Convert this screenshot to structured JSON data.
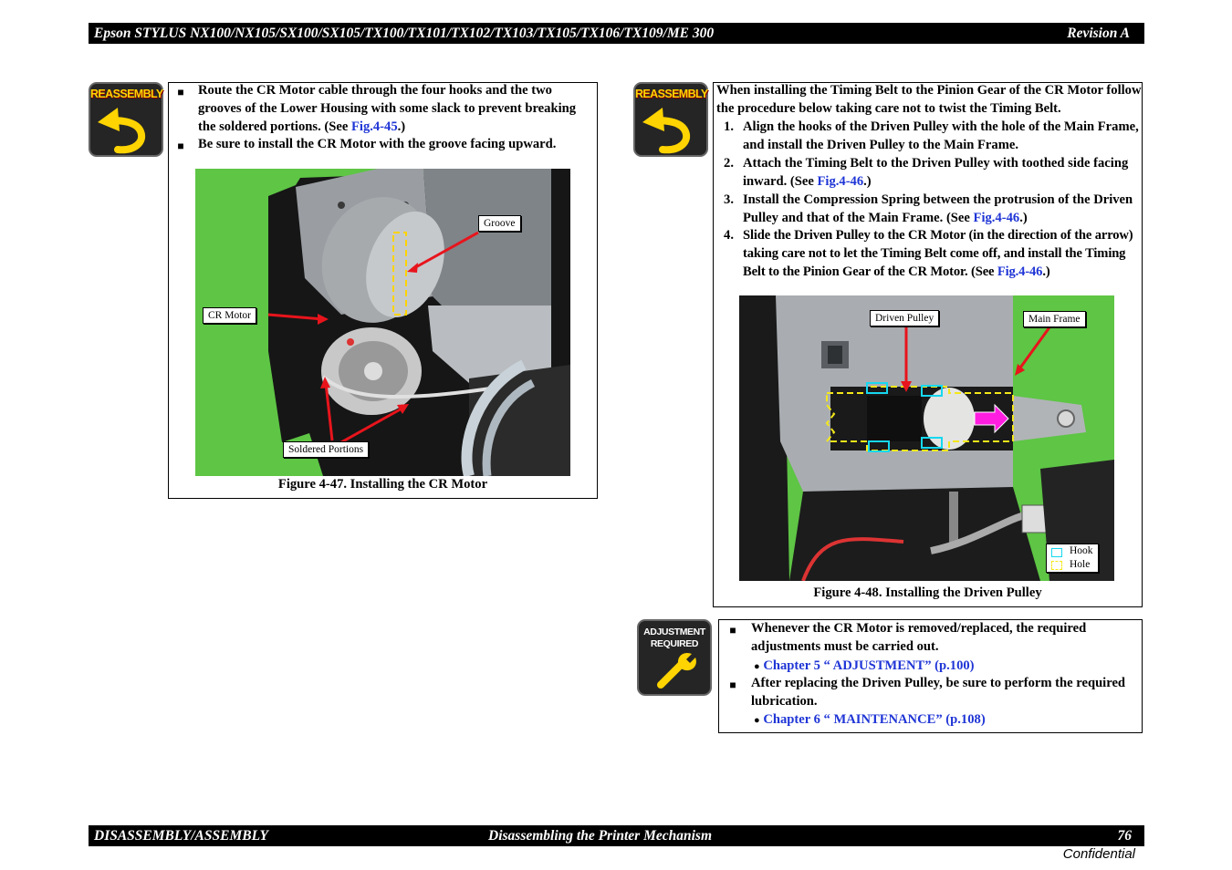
{
  "header": {
    "title": "Epson STYLUS NX100/NX105/SX100/SX105/TX100/TX101/TX102/TX103/TX105/TX106/TX109/ME 300",
    "revision": "Revision A"
  },
  "footer": {
    "section": "DISASSEMBLY/ASSEMBLY",
    "subsection": "Disassembling the Printer Mechanism",
    "page": "76",
    "confidential": "Confidential"
  },
  "icons": {
    "reassembly": "REASSEMBLY",
    "adjustment_line1": "ADJUSTMENT",
    "adjustment_line2": "REQUIRED"
  },
  "left_note": {
    "bullet1_pre": "Route the CR Motor cable through the four hooks and the two grooves of the Lower Housing with some slack to prevent breaking the soldered portions. (See ",
    "bullet1_link": "Fig.4-45",
    "bullet1_post": ".)",
    "bullet2": "Be sure to install the CR Motor with the groove facing upward.",
    "figure_caption": "Figure 4-47.  Installing the CR Motor",
    "labels": {
      "groove": "Groove",
      "cr_motor": "CR Motor",
      "soldered": "Soldered Portions"
    }
  },
  "right_note": {
    "intro": "When installing the Timing Belt to the Pinion Gear of the CR Motor follow the procedure below taking care not to twist the Timing Belt.",
    "steps": [
      {
        "num": "1.",
        "text": "Align the hooks of the Driven Pulley with the hole of the Main Frame, and install the Driven Pulley to the Main Frame."
      },
      {
        "num": "2.",
        "pre": "Attach the Timing Belt to the Driven Pulley with toothed side facing inward. (See ",
        "link": "Fig.4-46",
        "post": ".)"
      },
      {
        "num": "3.",
        "pre": "Install the Compression Spring between the protrusion of the Driven Pulley and that of the Main Frame. (See ",
        "link": "Fig.4-46",
        "post": ".)"
      },
      {
        "num": "4.",
        "pre": "Slide the Driven Pulley to the CR Motor (in the direction of the arrow) taking care not to let the Timing Belt come off, and install the Timing Belt to the Pinion Gear of the CR Motor. (See ",
        "link": "Fig.4-46",
        "post": ".)"
      }
    ],
    "figure_caption": "Figure 4-48.  Installing the Driven Pulley",
    "labels": {
      "driven_pulley": "Driven Pulley",
      "main_frame": "Main Frame",
      "legend_hook": "Hook",
      "legend_hole": "Hole"
    }
  },
  "adjust_note": {
    "bullet1": "Whenever the CR Motor is removed/replaced, the required adjustments must be carried out.",
    "link1": "Chapter 5 “ ADJUSTMENT” (p.100)",
    "bullet2": "After replacing the Driven Pulley, be sure to perform the required lubrication.",
    "link2": "Chapter 6 “ MAINTENANCE” (p.108)"
  },
  "colors": {
    "link": "#1f35d6",
    "icon_bg": "#252525",
    "reassembly_text": "#ffd400",
    "photo_green": "#5ec545",
    "callout_red": "#e8141c",
    "hook_cyan": "#16d8f0",
    "hole_yellow": "#f4e81a",
    "arrow_magenta": "#ff1ee0"
  }
}
